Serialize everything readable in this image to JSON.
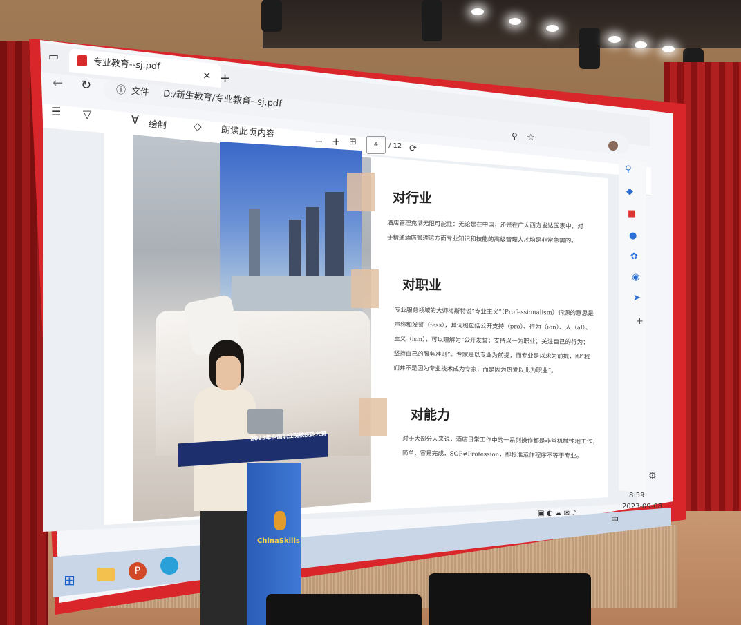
{
  "browser": {
    "tab_title": "专业教育--sj.pdf",
    "close_glyph": "×",
    "new_tab_glyph": "+",
    "address_label": "文件",
    "address_path": "D:/新生教育/专业教育--sj.pdf"
  },
  "pdf_toolbar": {
    "draw_label": "绘制",
    "read_aloud_label": "朗读此页内容",
    "page_current": "4",
    "page_total": "/ 12"
  },
  "document": {
    "sections": [
      {
        "title": "对行业",
        "body": "酒店管理充满无限可能性：无论是在中国，还是在广大西方发达国家中，对于精通酒店管理这方面专业知识和技能的高级管理人才均是非常急需的。"
      },
      {
        "title": "对职业",
        "body": "专业服务领域的大师梅斯特说“专业主义”（Professionalism）词源的意思是声称和发誓（fess），其词缀包括公开支持（pro）、行为（ion）、人（al）、主义（ism），可以理解为“公开发誓；支持以一为职业；关注自己的行为；坚持自己的服务准则”。专家是以专业为前提，而专业是以求为前提，即“我们并不是因为专业技术成为专家，而是因为热爱以此为职业”。"
      },
      {
        "title": "对能力",
        "body": "对于大部分人来说，酒店日常工作中的一系列操作都是非常机械性地工作，简单、容易完成，SOP≠Profession，即标准运作程序不等于专业。"
      }
    ]
  },
  "taskbar": {
    "time": "8:59",
    "date": "2023-09-08",
    "ime": "中"
  },
  "podium": {
    "banner_title": "2023年全国职业院校技能大赛",
    "brand": "ChinaSkills"
  },
  "icons": [
    "tab-icon",
    "pdf-file-icon",
    "back-icon",
    "refresh-icon",
    "info-icon",
    "contents-icon",
    "highlight-icon",
    "draw-icon",
    "eraser-icon",
    "zoom-out-icon",
    "zoom-in-icon",
    "fit-icon",
    "rotate-icon",
    "search-icon",
    "favorite-icon",
    "windows-start-icon",
    "file-explorer-icon",
    "powerpoint-icon",
    "edge-icon"
  ]
}
